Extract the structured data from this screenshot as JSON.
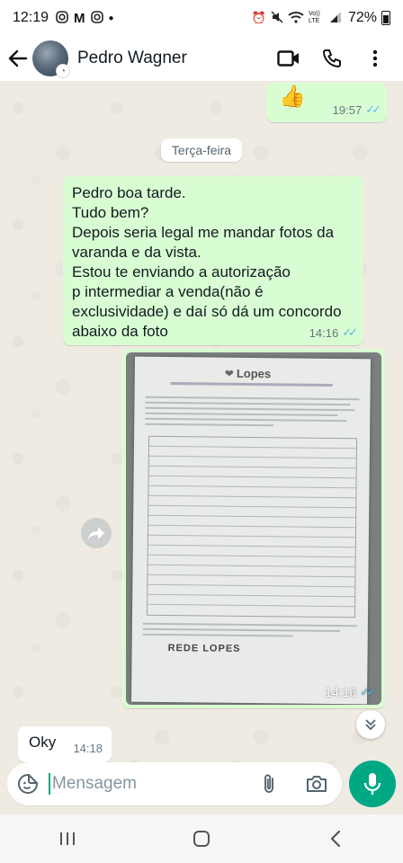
{
  "status_bar": {
    "time": "12:19",
    "left_icons": [
      "instagram-icon",
      "gmail-icon",
      "notification-dot-icon"
    ],
    "right_icons": [
      "alarm-icon",
      "mute-icon",
      "wifi-icon",
      "volte-icon",
      "signal-icon"
    ],
    "network_label": "Vo)) LTE",
    "battery": "72%"
  },
  "header": {
    "contact_name": "Pedro Wagner",
    "actions": [
      "video-call-icon",
      "phone-icon",
      "more-options-icon"
    ]
  },
  "messages": {
    "emoji_message": {
      "content": "👍",
      "time": "19:57",
      "status": "read"
    },
    "day_separator": "Terça-feira",
    "text_message": {
      "text": "Pedro boa tarde.\nTudo bem?\nDepois seria legal me mandar fotos da varanda e da vista.\nEstou te enviando a autorização\np intermediar a venda(não é exclusividade) e daí só dá um concordo abaixo da foto",
      "time": "14:16",
      "status": "read"
    },
    "photo_message": {
      "document_brand": "Lopes",
      "document_footer": "REDE LOPES",
      "time": "14:16",
      "status": "read"
    },
    "incoming_message": {
      "text": "Oky",
      "time": "14:18"
    }
  },
  "composer": {
    "placeholder": "Mensagem",
    "value": ""
  },
  "colors": {
    "accent": "#00a884",
    "outgoing_bubble": "#d9fdd3",
    "read_ticks": "#53bdeb",
    "chat_background": "#efeae2"
  }
}
